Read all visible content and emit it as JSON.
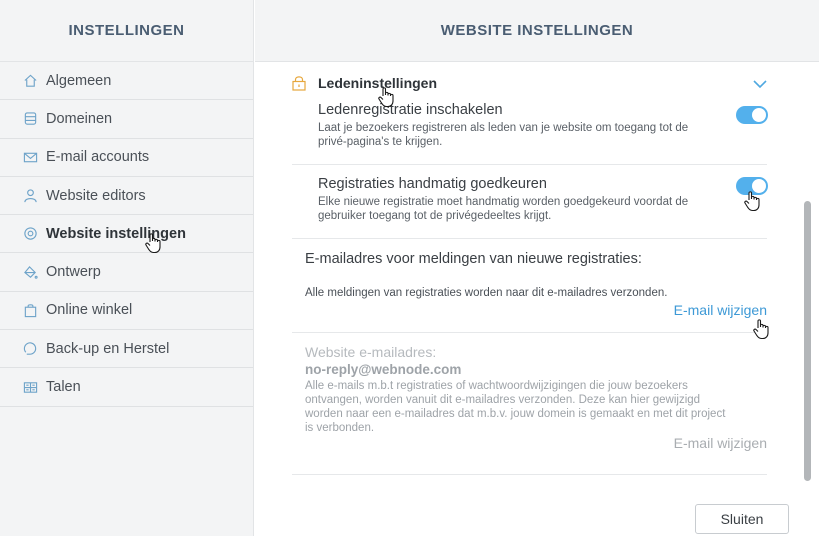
{
  "sidebar": {
    "title": "INSTELLINGEN",
    "items": [
      {
        "label": "Algemeen",
        "icon": "home-icon"
      },
      {
        "label": "Domeinen",
        "icon": "database-icon"
      },
      {
        "label": "E-mail accounts",
        "icon": "envelope-icon"
      },
      {
        "label": "Website editors",
        "icon": "user-icon"
      },
      {
        "label": "Website instellingen",
        "icon": "gear-icon",
        "active": true
      },
      {
        "label": "Ontwerp",
        "icon": "paint-bucket-icon"
      },
      {
        "label": "Online winkel",
        "icon": "shopping-bag-icon"
      },
      {
        "label": "Back-up en Herstel",
        "icon": "backup-icon"
      },
      {
        "label": "Talen",
        "icon": "languages-icon"
      }
    ]
  },
  "main": {
    "title": "WEBSITE INSTELLINGEN",
    "section": {
      "title": "Ledeninstellingen",
      "icon": "lock-icon"
    },
    "settings": [
      {
        "title": "Ledenregistratie inschakelen",
        "description": "Laat je bezoekers registreren als leden van je website om toegang tot de privé-pagina's te krijgen.",
        "enabled": true
      },
      {
        "title": "Registraties handmatig goedkeuren",
        "description": "Elke nieuwe registratie moet handmatig worden goedgekeurd voordat de gebruiker toegang tot de privégedeeltes krijgt.",
        "enabled": true
      }
    ],
    "notification": {
      "heading": "E-mailadres voor meldingen van nieuwe registraties:",
      "text": "Alle meldingen van registraties worden naar dit e-mailadres verzonden.",
      "link": "E-mail wijzigen"
    },
    "sender": {
      "title": "Website e-mailadres:",
      "email": "no-reply@webnode.com",
      "description": "Alle e-mails m.b.t registraties of wachtwoordwijzigingen die jouw bezoekers ontvangen, worden vanuit dit e-mailadres verzonden. Deze kan hier gewijzigd worden naar een e-mailadres dat m.b.v. jouw domein is gemaakt en met dit project is verbonden.",
      "link": "E-mail wijzigen"
    }
  },
  "footer": {
    "close_label": "Sluiten"
  },
  "colors": {
    "accent": "#53b0ec",
    "link": "#3d99d6",
    "lock": "#e7a73c",
    "heading": "#4a5d72"
  }
}
